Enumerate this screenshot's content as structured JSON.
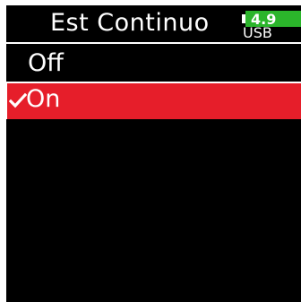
{
  "header": {
    "title": "Est Continuo",
    "battery_voltage": "4.9",
    "power_source": "USB"
  },
  "menu": {
    "items": [
      {
        "label": "Off",
        "selected": false
      },
      {
        "label": "On",
        "selected": true
      }
    ]
  },
  "colors": {
    "background": "#000000",
    "selection": "#e61e2a",
    "battery": "#2bb52b",
    "text": "#ffffff"
  },
  "icons": {
    "selected_marker": "checkmark-icon"
  }
}
